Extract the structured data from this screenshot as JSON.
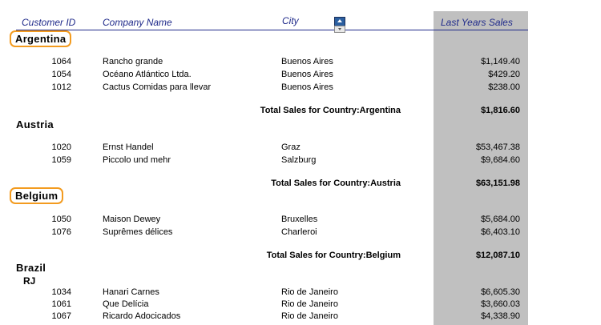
{
  "headers": {
    "customer_id": "Customer ID",
    "company_name": "Company Name",
    "city": "City",
    "last_years_sales": "Last Years Sales"
  },
  "groups": [
    {
      "country": "Argentina",
      "rows": [
        {
          "id": "1064",
          "company": "Rancho grande",
          "city": "Buenos Aires",
          "sales": "$1,149.40"
        },
        {
          "id": "1054",
          "company": "Océano Atlántico Ltda.",
          "city": "Buenos Aires",
          "sales": "$429.20"
        },
        {
          "id": "1012",
          "company": "Cactus Comidas para llevar",
          "city": "Buenos Aires",
          "sales": "$238.00"
        }
      ],
      "total_label": "Total Sales for Country:Argentina",
      "total": "$1,816.60"
    },
    {
      "country": "Austria",
      "rows": [
        {
          "id": "1020",
          "company": "Ernst Handel",
          "city": "Graz",
          "sales": "$53,467.38"
        },
        {
          "id": "1059",
          "company": "Piccolo und mehr",
          "city": "Salzburg",
          "sales": "$9,684.60"
        }
      ],
      "total_label": "Total Sales for Country:Austria",
      "total": "$63,151.98"
    },
    {
      "country": "Belgium",
      "rows": [
        {
          "id": "1050",
          "company": "Maison Dewey",
          "city": "Bruxelles",
          "sales": "$5,684.00"
        },
        {
          "id": "1076",
          "company": "Suprêmes délices",
          "city": "Charleroi",
          "sales": "$6,403.10"
        }
      ],
      "total_label": "Total Sales for Country:Belgium",
      "total": "$12,087.10"
    },
    {
      "country": "Brazil",
      "region": "RJ",
      "rows": [
        {
          "id": "1034",
          "company": "Hanari Carnes",
          "city": "Rio de Janeiro",
          "sales": "$6,605.30"
        },
        {
          "id": "1061",
          "company": "Que Delícia",
          "city": "Rio de Janeiro",
          "sales": "$3,660.03"
        },
        {
          "id": "1067",
          "company": "Ricardo Adocicados",
          "city": "Rio de Janeiro",
          "sales": "$4,338.90"
        }
      ]
    }
  ],
  "highlight_color": "#f39b1f",
  "header_color": "#1f2a8a",
  "sales_column_color": "#c0c0c0"
}
